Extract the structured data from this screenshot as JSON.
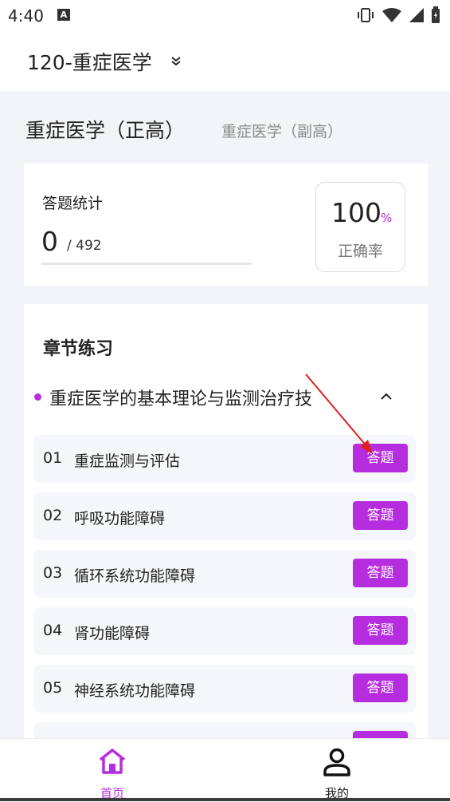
{
  "status_bar": {
    "time": "4:40",
    "notification_icon_text": "A"
  },
  "header": {
    "subject": "120-重症医学"
  },
  "tabs": [
    {
      "label": "重症医学（正高）",
      "active": true
    },
    {
      "label": "重症医学（副高）",
      "active": false
    }
  ],
  "stats": {
    "label": "答题统计",
    "answered": "0",
    "total": "/ 492",
    "progress": 0,
    "rate_value": "100",
    "rate_unit": "%",
    "rate_label": "正确率"
  },
  "chapter": {
    "title": "章节练习",
    "section_title": "重症医学的基本理论与监测治疗技",
    "items": [
      {
        "num": "01",
        "label": "重症监测与评估",
        "button": "答题"
      },
      {
        "num": "02",
        "label": "呼吸功能障碍",
        "button": "答题"
      },
      {
        "num": "03",
        "label": "循环系统功能障碍",
        "button": "答题"
      },
      {
        "num": "04",
        "label": "肾功能障碍",
        "button": "答题"
      },
      {
        "num": "05",
        "label": "神经系统功能障碍",
        "button": "答题"
      }
    ]
  },
  "bottom_nav": {
    "home_label": "首页",
    "mine_label": "我的"
  },
  "colors": {
    "accent": "#b62de0",
    "arrow": "#e02020"
  }
}
